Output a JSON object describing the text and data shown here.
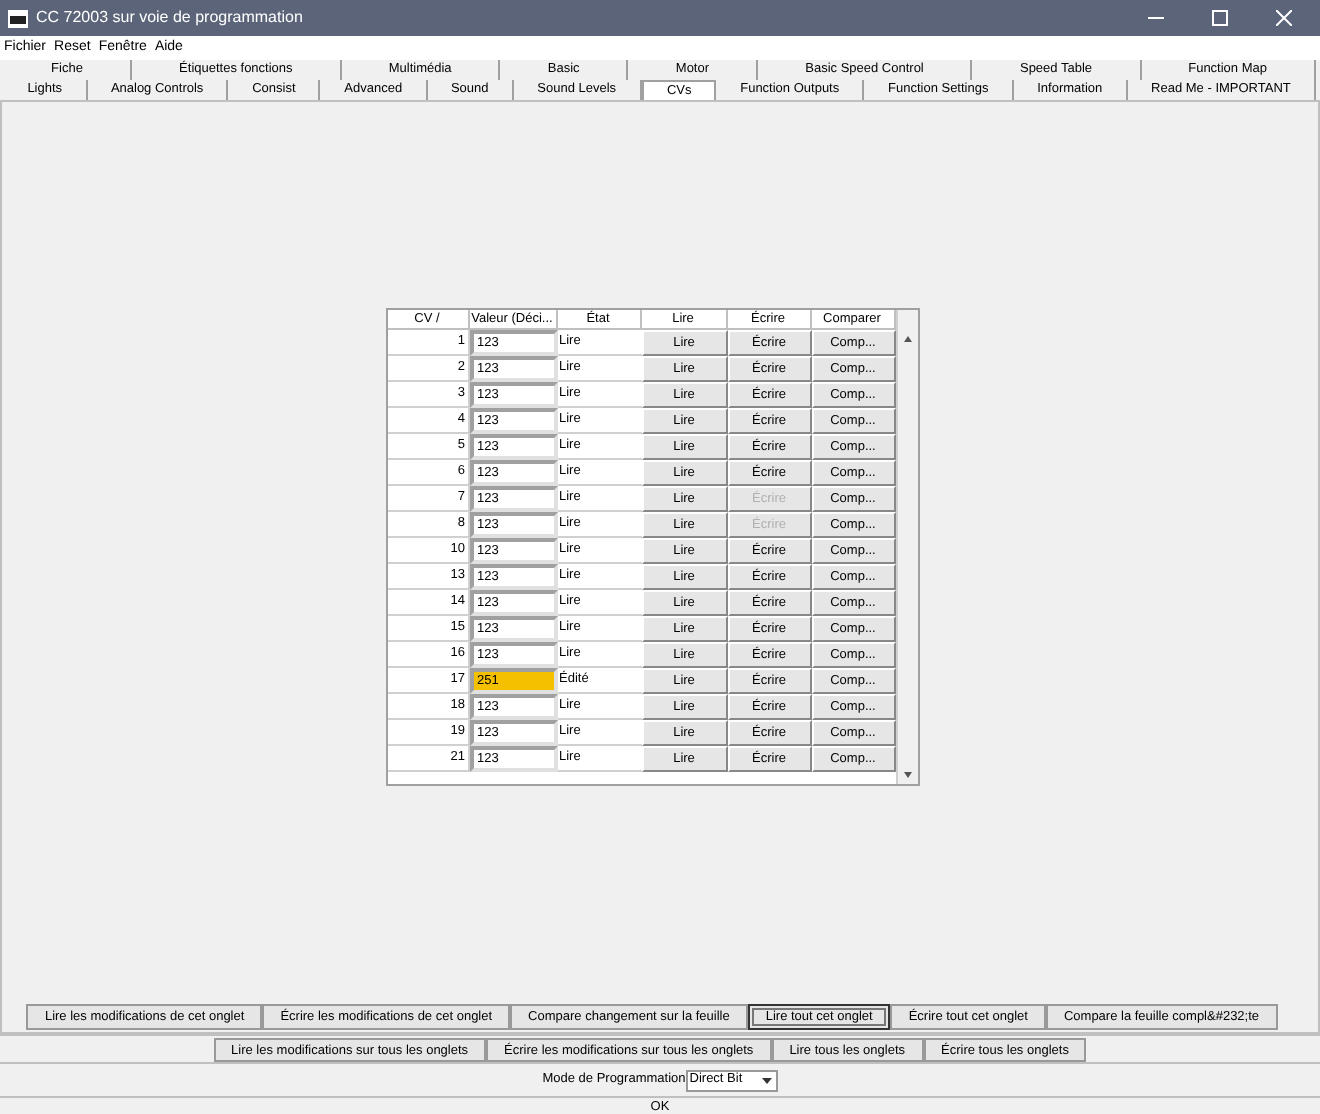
{
  "window": {
    "title": "CC 72003 sur voie de programmation"
  },
  "menu": [
    "Fichier",
    "Reset",
    "Fenêtre",
    "Aide"
  ],
  "tabs_row_1": [
    {
      "label": "Fiche",
      "selected": false
    },
    {
      "label": "Étiquettes fonctions",
      "selected": false
    },
    {
      "label": "Multimédia",
      "selected": false
    },
    {
      "label": "Basic",
      "selected": false
    },
    {
      "label": "Motor",
      "selected": false
    },
    {
      "label": "Basic Speed Control",
      "selected": false
    },
    {
      "label": "Speed Table",
      "selected": false
    },
    {
      "label": "Function Map",
      "selected": false
    }
  ],
  "tabs_row_2": [
    {
      "label": "Lights",
      "selected": false
    },
    {
      "label": "Analog Controls",
      "selected": false
    },
    {
      "label": "Consist",
      "selected": false
    },
    {
      "label": "Advanced",
      "selected": false
    },
    {
      "label": "Sound",
      "selected": false
    },
    {
      "label": "Sound Levels",
      "selected": false
    },
    {
      "label": "CVs",
      "selected": true
    },
    {
      "label": "Function Outputs",
      "selected": false
    },
    {
      "label": "Function Settings",
      "selected": false
    },
    {
      "label": "Information",
      "selected": false
    },
    {
      "label": "Read Me - IMPORTANT",
      "selected": false
    }
  ],
  "table": {
    "columns": [
      "CV  /",
      "Valeur (Déci...",
      "État",
      "Lire",
      "Écrire",
      "Comparer"
    ],
    "rows": [
      {
        "cv": "1",
        "value": "123",
        "state": "Lire",
        "read": "Lire",
        "write": "Écrire",
        "compare": "Comp...",
        "edited": false,
        "write_disabled": false
      },
      {
        "cv": "2",
        "value": "123",
        "state": "Lire",
        "read": "Lire",
        "write": "Écrire",
        "compare": "Comp...",
        "edited": false,
        "write_disabled": false
      },
      {
        "cv": "3",
        "value": "123",
        "state": "Lire",
        "read": "Lire",
        "write": "Écrire",
        "compare": "Comp...",
        "edited": false,
        "write_disabled": false
      },
      {
        "cv": "4",
        "value": "123",
        "state": "Lire",
        "read": "Lire",
        "write": "Écrire",
        "compare": "Comp...",
        "edited": false,
        "write_disabled": false
      },
      {
        "cv": "5",
        "value": "123",
        "state": "Lire",
        "read": "Lire",
        "write": "Écrire",
        "compare": "Comp...",
        "edited": false,
        "write_disabled": false
      },
      {
        "cv": "6",
        "value": "123",
        "state": "Lire",
        "read": "Lire",
        "write": "Écrire",
        "compare": "Comp...",
        "edited": false,
        "write_disabled": false
      },
      {
        "cv": "7",
        "value": "123",
        "state": "Lire",
        "read": "Lire",
        "write": "Écrire",
        "compare": "Comp...",
        "edited": false,
        "write_disabled": true
      },
      {
        "cv": "8",
        "value": "123",
        "state": "Lire",
        "read": "Lire",
        "write": "Écrire",
        "compare": "Comp...",
        "edited": false,
        "write_disabled": true
      },
      {
        "cv": "10",
        "value": "123",
        "state": "Lire",
        "read": "Lire",
        "write": "Écrire",
        "compare": "Comp...",
        "edited": false,
        "write_disabled": false
      },
      {
        "cv": "13",
        "value": "123",
        "state": "Lire",
        "read": "Lire",
        "write": "Écrire",
        "compare": "Comp...",
        "edited": false,
        "write_disabled": false
      },
      {
        "cv": "14",
        "value": "123",
        "state": "Lire",
        "read": "Lire",
        "write": "Écrire",
        "compare": "Comp...",
        "edited": false,
        "write_disabled": false
      },
      {
        "cv": "15",
        "value": "123",
        "state": "Lire",
        "read": "Lire",
        "write": "Écrire",
        "compare": "Comp...",
        "edited": false,
        "write_disabled": false
      },
      {
        "cv": "16",
        "value": "123",
        "state": "Lire",
        "read": "Lire",
        "write": "Écrire",
        "compare": "Comp...",
        "edited": false,
        "write_disabled": false
      },
      {
        "cv": "17",
        "value": "251",
        "state": "Édité",
        "read": "Lire",
        "write": "Écrire",
        "compare": "Comp...",
        "edited": true,
        "write_disabled": false
      },
      {
        "cv": "18",
        "value": "123",
        "state": "Lire",
        "read": "Lire",
        "write": "Écrire",
        "compare": "Comp...",
        "edited": false,
        "write_disabled": false
      },
      {
        "cv": "19",
        "value": "123",
        "state": "Lire",
        "read": "Lire",
        "write": "Écrire",
        "compare": "Comp...",
        "edited": false,
        "write_disabled": false
      },
      {
        "cv": "21",
        "value": "123",
        "state": "Lire",
        "read": "Lire",
        "write": "Écrire",
        "compare": "Comp...",
        "edited": false,
        "write_disabled": false
      }
    ]
  },
  "sheet_buttons": [
    {
      "label": "Lire les modifications de cet onglet",
      "focused": false
    },
    {
      "label": "Écrire les modifications de cet onglet",
      "focused": false
    },
    {
      "label": "Compare changement sur la feuille",
      "focused": false
    },
    {
      "label": "Lire tout cet onglet",
      "focused": true
    },
    {
      "label": "Écrire tout cet onglet",
      "focused": false
    },
    {
      "label": "Compare la feuille compl&#232;te",
      "focused": false
    }
  ],
  "all_tabs_buttons": [
    "Lire les modifications sur tous les onglets",
    "Écrire les modifications sur tous les onglets",
    "Lire tous les onglets",
    "Écrire tous les onglets"
  ],
  "programming_mode": {
    "label": "Mode de Programmation",
    "value": "Direct Bit"
  },
  "status_bar": "OK"
}
